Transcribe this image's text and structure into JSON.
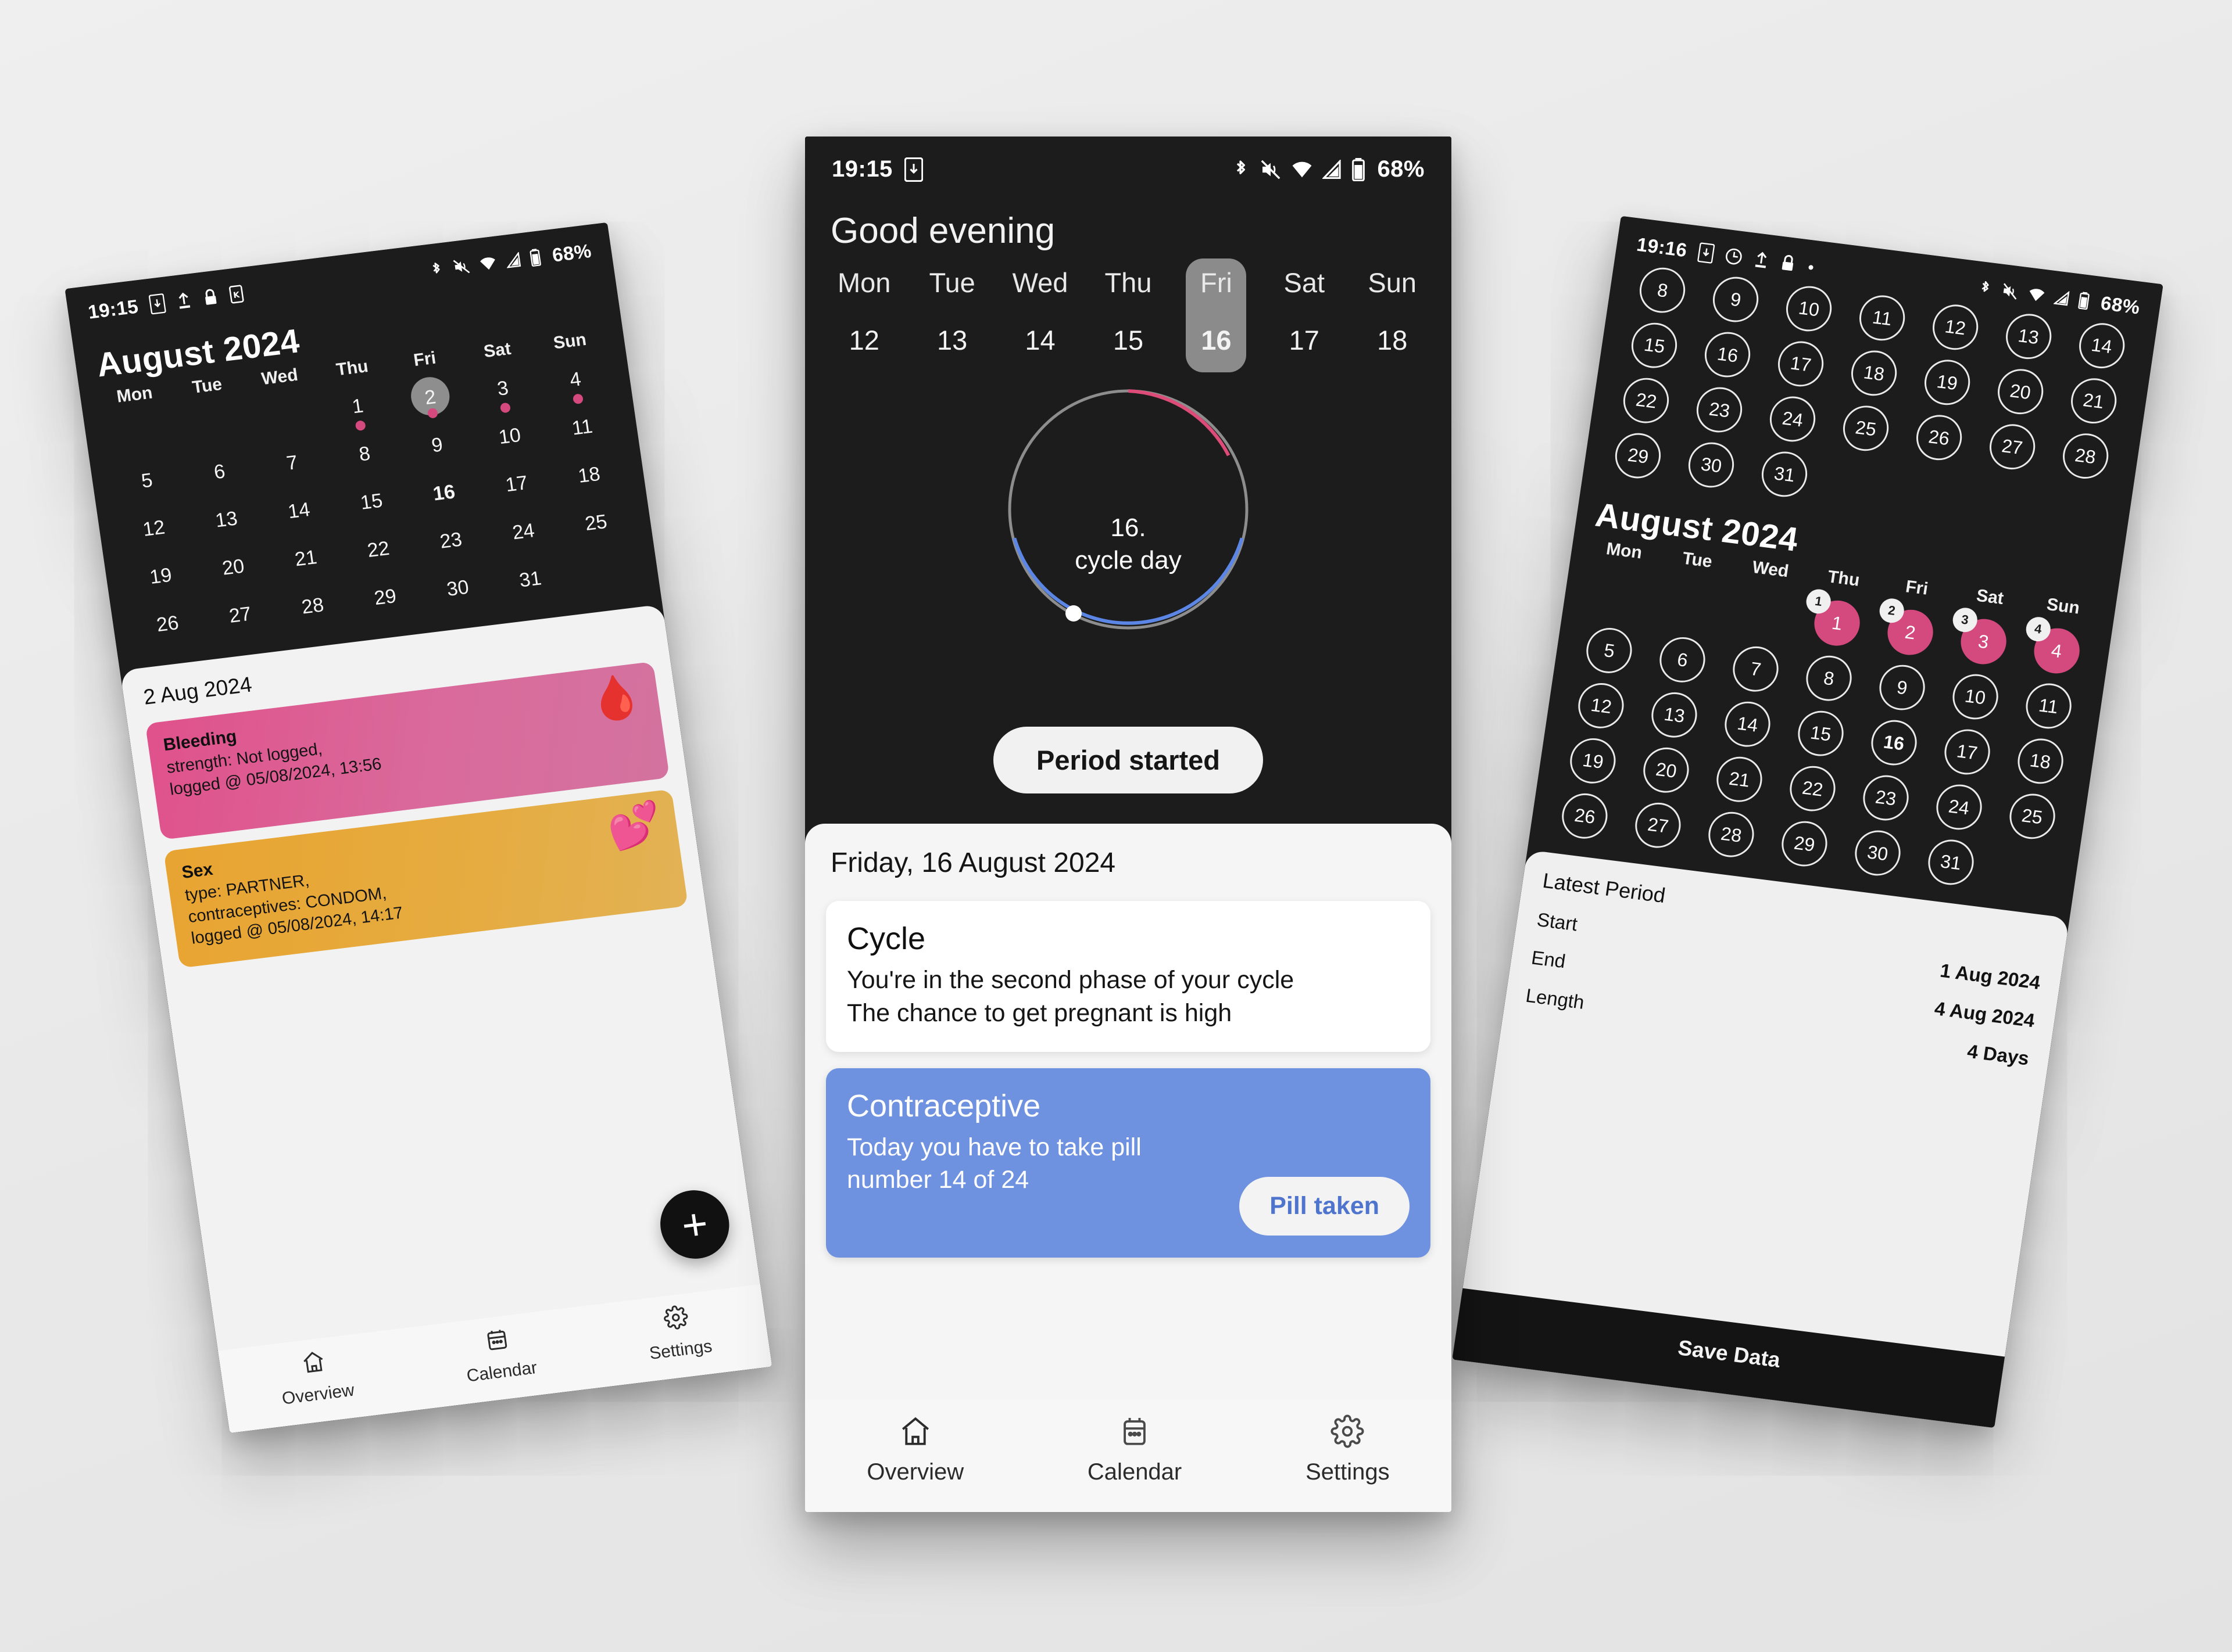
{
  "background_color": "#ebebeb",
  "accent_colors": {
    "period_pink": "#d4497e",
    "card_pink": "#e0518b",
    "card_orange": "#e8a431",
    "contraceptive_blue": "#6e91e0",
    "ring_blue": "#5b86e5",
    "ring_gray": "#8d8d8d",
    "dark_surface": "#1c1c1c"
  },
  "phones": {
    "center": {
      "status_bar": {
        "time": "19:15",
        "battery": "68%",
        "icons": [
          "phone-download-icon",
          "bluetooth-icon",
          "mute-icon",
          "wifi-icon",
          "signal-icon",
          "battery-icon"
        ]
      },
      "greeting": "Good evening",
      "week_strip": {
        "days": [
          {
            "dow": "Mon",
            "num": "12",
            "selected": false
          },
          {
            "dow": "Tue",
            "num": "13",
            "selected": false
          },
          {
            "dow": "Wed",
            "num": "14",
            "selected": false
          },
          {
            "dow": "Thu",
            "num": "15",
            "selected": false
          },
          {
            "dow": "Fri",
            "num": "16",
            "selected": true
          },
          {
            "dow": "Sat",
            "num": "17",
            "selected": false
          },
          {
            "dow": "Sun",
            "num": "18",
            "selected": false
          }
        ]
      },
      "ring": {
        "center_line1": "16.",
        "center_line2": "cycle day"
      },
      "period_button": "Period started",
      "sheet": {
        "date_header": "Friday, 16 August 2024",
        "cards": [
          {
            "title": "Cycle",
            "line1": "You're in the second phase of your cycle",
            "line2": "The chance to get pregnant is high"
          },
          {
            "title": "Contraceptive",
            "line1": "Today you have to take pill",
            "line2": "number 14 of 24",
            "button": "Pill taken"
          }
        ]
      },
      "nav": [
        {
          "label": "Overview",
          "icon": "home-icon"
        },
        {
          "label": "Calendar",
          "icon": "calendar-icon"
        },
        {
          "label": "Settings",
          "icon": "gear-icon"
        }
      ]
    },
    "left": {
      "status_bar": {
        "time": "19:15",
        "battery": "68%",
        "icons": [
          "phone-download-icon",
          "upload-icon",
          "lock-icon",
          "sim-icon",
          "bluetooth-icon",
          "mute-icon",
          "wifi-icon",
          "signal-icon",
          "battery-icon"
        ]
      },
      "calendar_title": "August 2024",
      "weekday_headers": [
        "Mon",
        "Tue",
        "Wed",
        "Thu",
        "Fri",
        "Sat",
        "Sun"
      ],
      "weeks": [
        [
          {
            "n": ""
          },
          {
            "n": ""
          },
          {
            "n": ""
          },
          {
            "n": "1",
            "dot": true
          },
          {
            "n": "2",
            "dot": true,
            "today": true
          },
          {
            "n": "3",
            "dot": true
          },
          {
            "n": "4",
            "dot": true
          }
        ],
        [
          {
            "n": "5"
          },
          {
            "n": "6"
          },
          {
            "n": "7"
          },
          {
            "n": "8"
          },
          {
            "n": "9"
          },
          {
            "n": "10"
          },
          {
            "n": "11"
          }
        ],
        [
          {
            "n": "12"
          },
          {
            "n": "13"
          },
          {
            "n": "14"
          },
          {
            "n": "15"
          },
          {
            "n": "16",
            "bold": true
          },
          {
            "n": "17"
          },
          {
            "n": "18"
          }
        ],
        [
          {
            "n": "19"
          },
          {
            "n": "20"
          },
          {
            "n": "21"
          },
          {
            "n": "22"
          },
          {
            "n": "23"
          },
          {
            "n": "24"
          },
          {
            "n": "25"
          }
        ],
        [
          {
            "n": "26"
          },
          {
            "n": "27"
          },
          {
            "n": "28"
          },
          {
            "n": "29"
          },
          {
            "n": "30"
          },
          {
            "n": "31"
          },
          {
            "n": ""
          }
        ]
      ],
      "sheet_date": "2 Aug 2024",
      "entries": [
        {
          "title": "Bleeding",
          "line1": "strength: Not logged,",
          "line2": "logged @ 05/08/2024, 13:56",
          "emoji": "🩸",
          "emoji_name": "blood-drop-icon"
        },
        {
          "title": "Sex",
          "line1": "type: PARTNER,",
          "line2": "contraceptives: CONDOM,",
          "line3": "logged @ 05/08/2024, 14:17",
          "emoji": "💕",
          "emoji_name": "two-hearts-icon"
        }
      ],
      "fab": "+",
      "nav": [
        {
          "label": "Overview",
          "icon": "home-icon"
        },
        {
          "label": "Calendar",
          "icon": "calendar-icon"
        },
        {
          "label": "Settings",
          "icon": "gear-icon"
        }
      ]
    },
    "right": {
      "status_bar": {
        "time": "19:16",
        "battery": "68%",
        "icons": [
          "phone-download-icon",
          "clock-icon",
          "upload-icon",
          "lock-icon",
          "dot-icon",
          "bluetooth-icon",
          "mute-icon",
          "wifi-icon",
          "signal-icon",
          "battery-icon"
        ]
      },
      "top_overlay_rows": [
        [
          "8",
          "9",
          "10",
          "11",
          "12",
          "13",
          "14"
        ],
        [
          "15",
          "16",
          "17",
          "18",
          "19",
          "20",
          "21"
        ],
        [
          "22",
          "23",
          "24",
          "25",
          "26",
          "27",
          "28"
        ],
        [
          "29",
          "30",
          "31",
          "",
          "",
          "",
          ""
        ]
      ],
      "calendar_title": "August 2024",
      "weekday_headers": [
        "Mon",
        "Tue",
        "Wed",
        "Thu",
        "Fri",
        "Sat",
        "Sun"
      ],
      "weeks": [
        [
          {
            "n": ""
          },
          {
            "n": ""
          },
          {
            "n": ""
          },
          {
            "n": "1",
            "period": true,
            "badge": "1"
          },
          {
            "n": "2",
            "period": true,
            "badge": "2"
          },
          {
            "n": "3",
            "period": true,
            "badge": "3"
          },
          {
            "n": "4",
            "period": true,
            "badge": "4"
          }
        ],
        [
          {
            "n": "5"
          },
          {
            "n": "6"
          },
          {
            "n": "7"
          },
          {
            "n": "8"
          },
          {
            "n": "9"
          },
          {
            "n": "10"
          },
          {
            "n": "11"
          }
        ],
        [
          {
            "n": "12"
          },
          {
            "n": "13"
          },
          {
            "n": "14"
          },
          {
            "n": "15"
          },
          {
            "n": "16",
            "bold": true
          },
          {
            "n": "17"
          },
          {
            "n": "18"
          }
        ],
        [
          {
            "n": "19"
          },
          {
            "n": "20"
          },
          {
            "n": "21"
          },
          {
            "n": "22"
          },
          {
            "n": "23"
          },
          {
            "n": "24"
          },
          {
            "n": "25"
          }
        ],
        [
          {
            "n": "26"
          },
          {
            "n": "27"
          },
          {
            "n": "28"
          },
          {
            "n": "29"
          },
          {
            "n": "30"
          },
          {
            "n": "31"
          },
          {
            "n": ""
          }
        ]
      ],
      "sheet": {
        "title": "Latest Period",
        "rows": [
          {
            "label": "Start",
            "value": "1 Aug 2024"
          },
          {
            "label": "End",
            "value": "4 Aug 2024"
          },
          {
            "label": "Length",
            "value": "4 Days"
          }
        ],
        "save_button": "Save Data"
      }
    }
  }
}
